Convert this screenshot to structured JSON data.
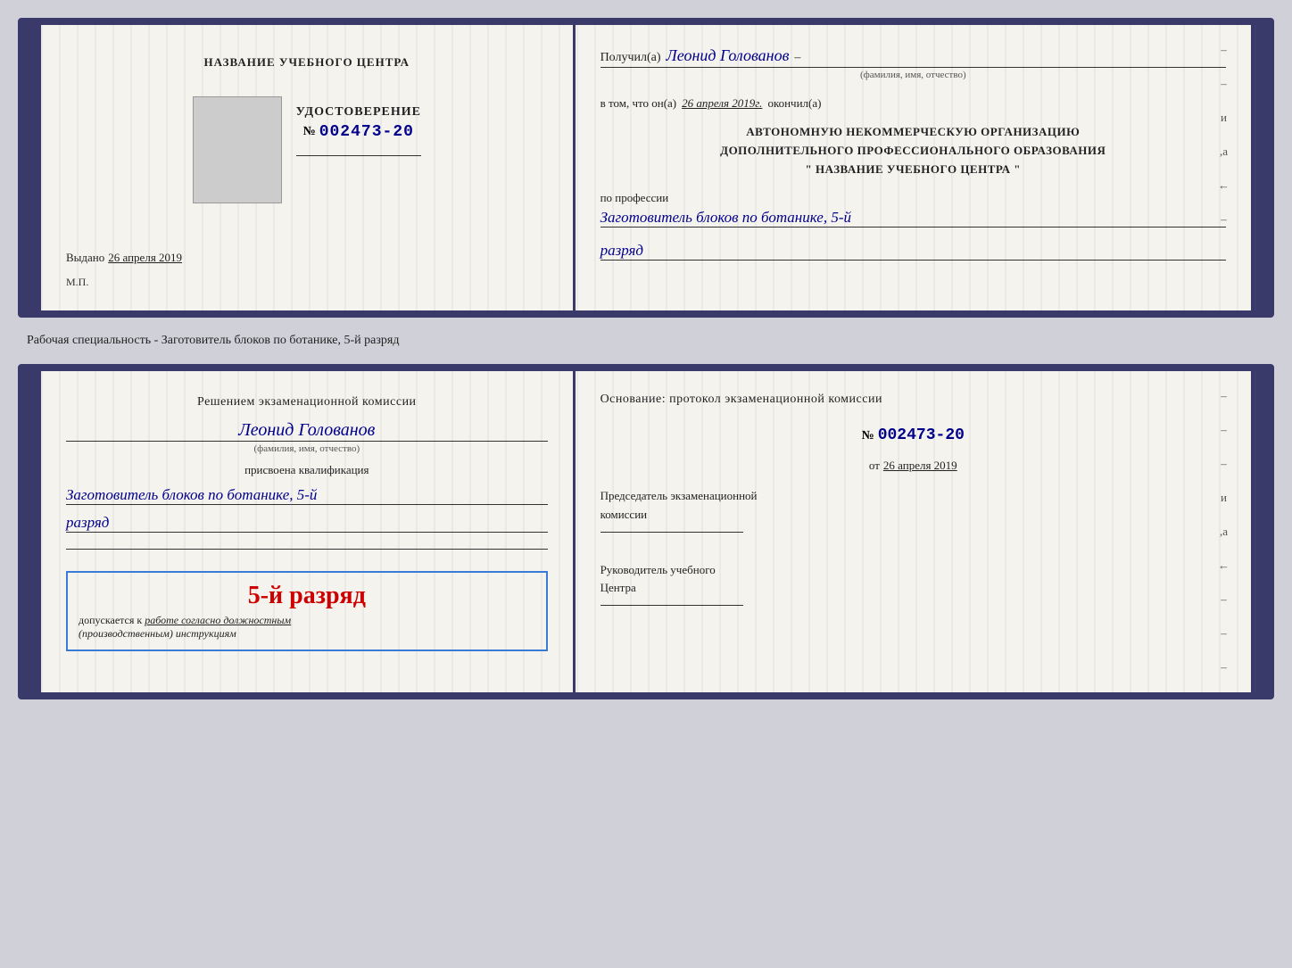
{
  "upper_doc": {
    "left": {
      "org_name": "НАЗВАНИЕ УЧЕБНОГО ЦЕНТРА",
      "cert_title": "УДОСТОВЕРЕНИЕ",
      "cert_number_prefix": "№",
      "cert_number": "002473-20",
      "issued_label": "Выдано",
      "issued_date": "26 апреля 2019",
      "mp_label": "М.П."
    },
    "right": {
      "received_prefix": "Получил(а)",
      "recipient_name": "Леонид Голованов",
      "recipient_sublabel": "(фамилия, имя, отчество)",
      "date_prefix": "в том, что он(а)",
      "date_value": "26 апреля 2019г.",
      "date_suffix": "окончил(а)",
      "org_line1": "АВТОНОМНУЮ НЕКОММЕРЧЕСКУЮ ОРГАНИЗАЦИЮ",
      "org_line2": "ДОПОЛНИТЕЛЬНОГО ПРОФЕССИОНАЛЬНОГО ОБРАЗОВАНИЯ",
      "org_line3": "\"    НАЗВАНИЕ УЧЕБНОГО ЦЕНТРА    \"",
      "profession_prefix": "по профессии",
      "profession_value": "Заготовитель блоков по ботанике, 5-й",
      "razryad_value": "разряд"
    }
  },
  "separator": {
    "text": "Рабочая специальность - Заготовитель блоков по ботанике, 5-й разряд"
  },
  "lower_doc": {
    "left": {
      "decision_line1": "Решением экзаменационной комиссии",
      "person_name": "Леонид Голованов",
      "person_sublabel": "(фамилия, имя, отчество)",
      "assigned_label": "присвоена квалификация",
      "qualification": "Заготовитель блоков по ботанике, 5-й",
      "razryad": "разряд",
      "stamp_grade": "5-й разряд",
      "stamp_admission": "допускается к",
      "stamp_work": "работе согласно должностным",
      "stamp_instructions": "(производственным) инструкциям"
    },
    "right": {
      "basis_label": "Основание: протокол экзаменационной комиссии",
      "protocol_prefix": "№",
      "protocol_number": "002473-20",
      "date_prefix": "от",
      "date_value": "26 апреля 2019",
      "chairman_title": "Председатель экзаменационной",
      "chairman_title2": "комиссии",
      "director_title": "Руководитель учебного",
      "director_title2": "Центра"
    }
  },
  "side_markers": {
    "dashes": [
      "–",
      "–",
      "–",
      "и",
      ",а",
      "←",
      "–",
      "–",
      "–",
      "–",
      "–"
    ]
  }
}
